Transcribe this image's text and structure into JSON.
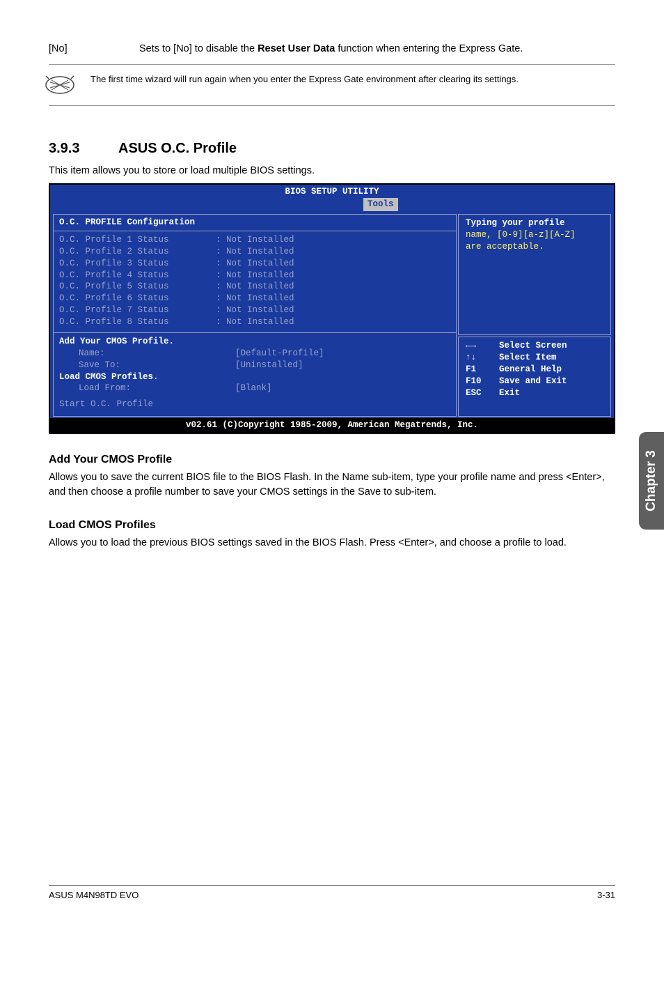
{
  "top_note": {
    "label": "[No]",
    "text_before": "Sets to [No] to disable the ",
    "bold": "Reset User Data",
    "text_after": " function when entering the Express Gate."
  },
  "info_text": "The first time wizard will run again when you enter the Express Gate environment after clearing its settings.",
  "section": {
    "num": "3.9.3",
    "title": "ASUS O.C. Profile"
  },
  "intro": "This item allows you to store or load multiple BIOS settings.",
  "bios": {
    "title": "BIOS SETUP UTILITY",
    "tab": "Tools",
    "config_title": "O.C. PROFILE Configuration",
    "profiles": [
      {
        "label": "O.C. Profile 1 Status",
        "value": ": Not Installed"
      },
      {
        "label": "O.C. Profile 2 Status",
        "value": ": Not Installed"
      },
      {
        "label": "O.C. Profile 3 Status",
        "value": ": Not Installed"
      },
      {
        "label": "O.C. Profile 4 Status",
        "value": ": Not Installed"
      },
      {
        "label": "O.C. Profile 5 Status",
        "value": ": Not Installed"
      },
      {
        "label": "O.C. Profile 6 Status",
        "value": ": Not Installed"
      },
      {
        "label": "O.C. Profile 7 Status",
        "value": ": Not Installed"
      },
      {
        "label": "O.C. Profile 8 Status",
        "value": ": Not Installed"
      }
    ],
    "add_profile_title": "Add Your CMOS Profile.",
    "name_label": "Name:",
    "name_value": "[Default-Profile]",
    "save_label": "Save To:",
    "save_value": "[Uninstalled]",
    "load_title": "Load CMOS Profiles.",
    "load_label": "Load From:",
    "load_value": "[Blank]",
    "start_label": "Start O.C. Profile",
    "help_header": "Typing your profile",
    "help_line1": "name, [0-9][a-z][A-Z]",
    "help_line2": "are acceptable.",
    "keys": [
      {
        "k": "←→",
        "d": "Select Screen"
      },
      {
        "k": "↑↓",
        "d": "Select Item"
      },
      {
        "k": "F1",
        "d": "General Help"
      },
      {
        "k": "F10",
        "d": "Save and Exit"
      },
      {
        "k": "ESC",
        "d": "Exit"
      }
    ],
    "footer": "v02.61 (C)Copyright 1985-2009, American Megatrends, Inc."
  },
  "sub1": {
    "title": "Add Your CMOS Profile",
    "text": "Allows you to save the current BIOS file to the BIOS Flash. In the Name sub-item, type your profile name and press <Enter>, and then choose a profile number to save your CMOS settings in the Save to sub-item."
  },
  "sub2": {
    "title": "Load CMOS Profiles",
    "text": "Allows you to load the previous BIOS settings saved in the BIOS Flash. Press <Enter>, and choose a profile to load."
  },
  "side_tab": "Chapter 3",
  "footer_left": "ASUS M4N98TD EVO",
  "footer_right": "3-31"
}
